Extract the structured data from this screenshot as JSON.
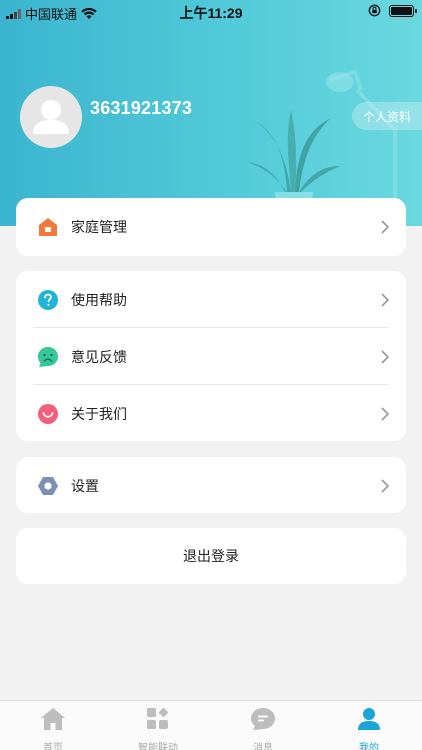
{
  "status_bar": {
    "carrier": "中国联通",
    "time": "上午11:29"
  },
  "profile": {
    "user_id": "3631921373",
    "profile_button": "个人资料"
  },
  "menu_groups": {
    "family": {
      "label": "家庭管理"
    },
    "help": {
      "label": "使用帮助"
    },
    "feedback": {
      "label": "意见反馈"
    },
    "about": {
      "label": "关于我们"
    },
    "settings": {
      "label": "设置"
    }
  },
  "logout_label": "退出登录",
  "tabbar": {
    "tabs": [
      {
        "label": "首页",
        "icon": "home-icon"
      },
      {
        "label": "智能联动",
        "icon": "smart-linkage-icon"
      },
      {
        "label": "消息",
        "icon": "message-icon"
      },
      {
        "label": "我的",
        "icon": "profile-icon",
        "active": true
      }
    ]
  },
  "colors": {
    "header_start": "#3bb5cf",
    "header_end": "#6ad8df",
    "active_tab": "#1aa6d4",
    "family_icon": "#f07a3c",
    "help_icon": "#1fb4d8",
    "feedback_icon": "#34c79a",
    "about_icon": "#f05e79",
    "settings_icon": "#7d8fb3"
  }
}
